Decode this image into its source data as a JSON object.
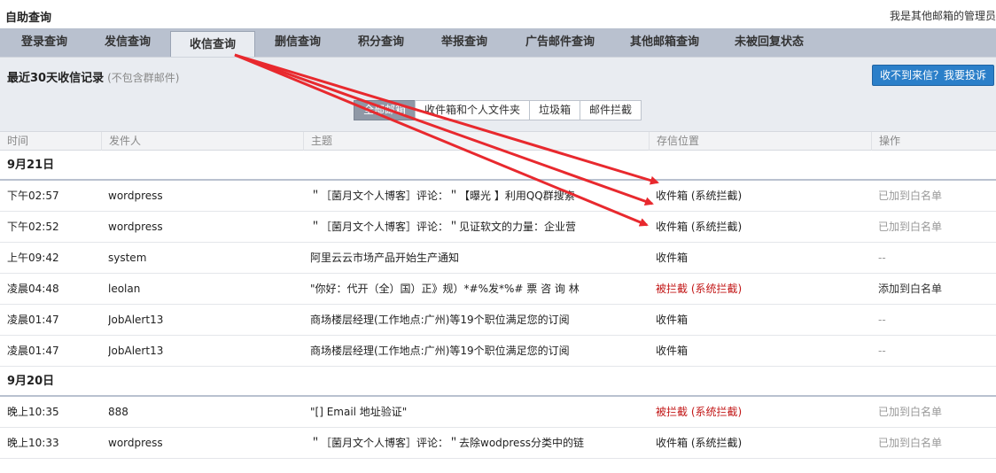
{
  "header": {
    "title": "自助查询",
    "right_text": "我是其他邮箱的管理员"
  },
  "tabs": [
    {
      "label": "登录查询"
    },
    {
      "label": "发信查询"
    },
    {
      "label": "收信查询"
    },
    {
      "label": "删信查询"
    },
    {
      "label": "积分查询"
    },
    {
      "label": "举报查询"
    },
    {
      "label": "广告邮件查询"
    },
    {
      "label": "其他邮箱查询"
    },
    {
      "label": "未被回复状态"
    }
  ],
  "panel": {
    "title": "最近30天收信记录",
    "note": "(不包含群邮件)",
    "complain_button": "收不到来信？我要投诉"
  },
  "filters": [
    {
      "label": "全部邮箱"
    },
    {
      "label": "收件箱和个人文件夹"
    },
    {
      "label": "垃圾箱"
    },
    {
      "label": "邮件拦截"
    }
  ],
  "columns": {
    "time": "时间",
    "sender": "发件人",
    "subject": "主题",
    "location": "存信位置",
    "action": "操作"
  },
  "groups": [
    {
      "date": "9月21日",
      "rows": [
        {
          "time": "下午02:57",
          "sender": "wordpress",
          "subject": "＂［菌月文个人博客］评论：＂【曝光 】利用QQ群搜索",
          "location": "收件箱 (系统拦截)",
          "action": "已加到白名单"
        },
        {
          "time": "下午02:52",
          "sender": "wordpress",
          "subject": "＂［菌月文个人博客］评论：＂见证软文的力量：企业营",
          "location": "收件箱 (系统拦截)",
          "action": "已加到白名单"
        },
        {
          "time": "上午09:42",
          "sender": "system",
          "subject": "阿里云云市场产品开始生产通知",
          "location": "收件箱",
          "action": "--"
        },
        {
          "time": "凌晨04:48",
          "sender": "leolan",
          "subject": "\"你好：代开（全）国）正》规）*#%发*%# 票 咨 询 林",
          "location": "被拦截 (系统拦截)",
          "action": "添加到白名单"
        },
        {
          "time": "凌晨01:47",
          "sender": "JobAlert13",
          "subject": "商场楼层经理(工作地点:广州)等19个职位满足您的订阅",
          "location": "收件箱",
          "action": "--"
        },
        {
          "time": "凌晨01:47",
          "sender": "JobAlert13",
          "subject": "商场楼层经理(工作地点:广州)等19个职位满足您的订阅",
          "location": "收件箱",
          "action": "--"
        }
      ]
    },
    {
      "date": "9月20日",
      "rows": [
        {
          "time": "晚上10:35",
          "sender": "888",
          "subject": "\"[] Email 地址验证\"",
          "location": "被拦截 (系统拦截)",
          "action": "已加到白名单"
        },
        {
          "time": "晚上10:33",
          "sender": "wordpress",
          "subject": "＂［菌月文个人博客］评论：＂去除wodpress分类中的链",
          "location": "收件箱 (系统拦截)",
          "action": "已加到白名单"
        }
      ]
    }
  ],
  "colors": {
    "tab_bar": "#b9c1cf",
    "panel_bg": "#e9ecf1",
    "button_blue": "#2b7fc9",
    "blocked_red": "#c21717",
    "annotation_arrow": "#e8292e"
  }
}
